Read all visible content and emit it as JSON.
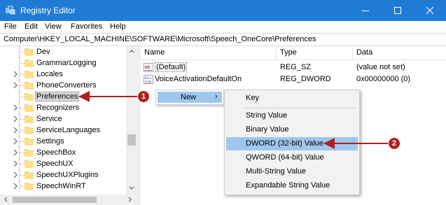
{
  "window": {
    "title": "Registry Editor",
    "title_bar_color": "#1f7bd6"
  },
  "menubar": {
    "file": "File",
    "edit": "Edit",
    "view": "View",
    "favorites": "Favorites",
    "help": "Help"
  },
  "address": {
    "path": "Computer\\HKEY_LOCAL_MACHINE\\SOFTWARE\\Microsoft\\Speech_OneCore\\Preferences"
  },
  "tree": {
    "items": [
      {
        "label": "Dev",
        "expandable": false
      },
      {
        "label": "GrammarLogging",
        "expandable": false
      },
      {
        "label": "Locales",
        "expandable": true
      },
      {
        "label": "PhoneConverters",
        "expandable": true
      },
      {
        "label": "Preferences",
        "expandable": false,
        "selected": true
      },
      {
        "label": "Recognizers",
        "expandable": true
      },
      {
        "label": "Service",
        "expandable": true
      },
      {
        "label": "ServiceLanguages",
        "expandable": true
      },
      {
        "label": "Settings",
        "expandable": true
      },
      {
        "label": "SpeechBox",
        "expandable": true
      },
      {
        "label": "SpeechUX",
        "expandable": true
      },
      {
        "label": "SpeechUXPlugins",
        "expandable": true
      },
      {
        "label": "SpeechWinRT",
        "expandable": true
      }
    ]
  },
  "values": {
    "columns": {
      "name": "Name",
      "type": "Type",
      "data": "Data"
    },
    "rows": [
      {
        "name": "(Default)",
        "type": "REG_SZ",
        "data": "(value not set)",
        "icon": "string-value-icon"
      },
      {
        "name": "VoiceActivationDefaultOn",
        "type": "REG_DWORD",
        "data": "0x00000000 (0)",
        "icon": "binary-value-icon"
      }
    ]
  },
  "context_menu": {
    "new_label": "New",
    "chevron": "›"
  },
  "submenu": {
    "key": "Key",
    "items": [
      {
        "label": "String Value"
      },
      {
        "label": "Binary Value"
      },
      {
        "label": "DWORD (32-bit) Value",
        "highlighted": true
      },
      {
        "label": "QWORD (64-bit) Value"
      },
      {
        "label": "Multi-String Value"
      },
      {
        "label": "Expandable String Value"
      }
    ]
  },
  "annotations": {
    "step1": "1",
    "step2": "2",
    "arrow_color": "#b02020"
  },
  "colors": {
    "menu_highlight": "#9fc7ee",
    "selection": "#d9d9d9",
    "folder": "#f8d775"
  }
}
